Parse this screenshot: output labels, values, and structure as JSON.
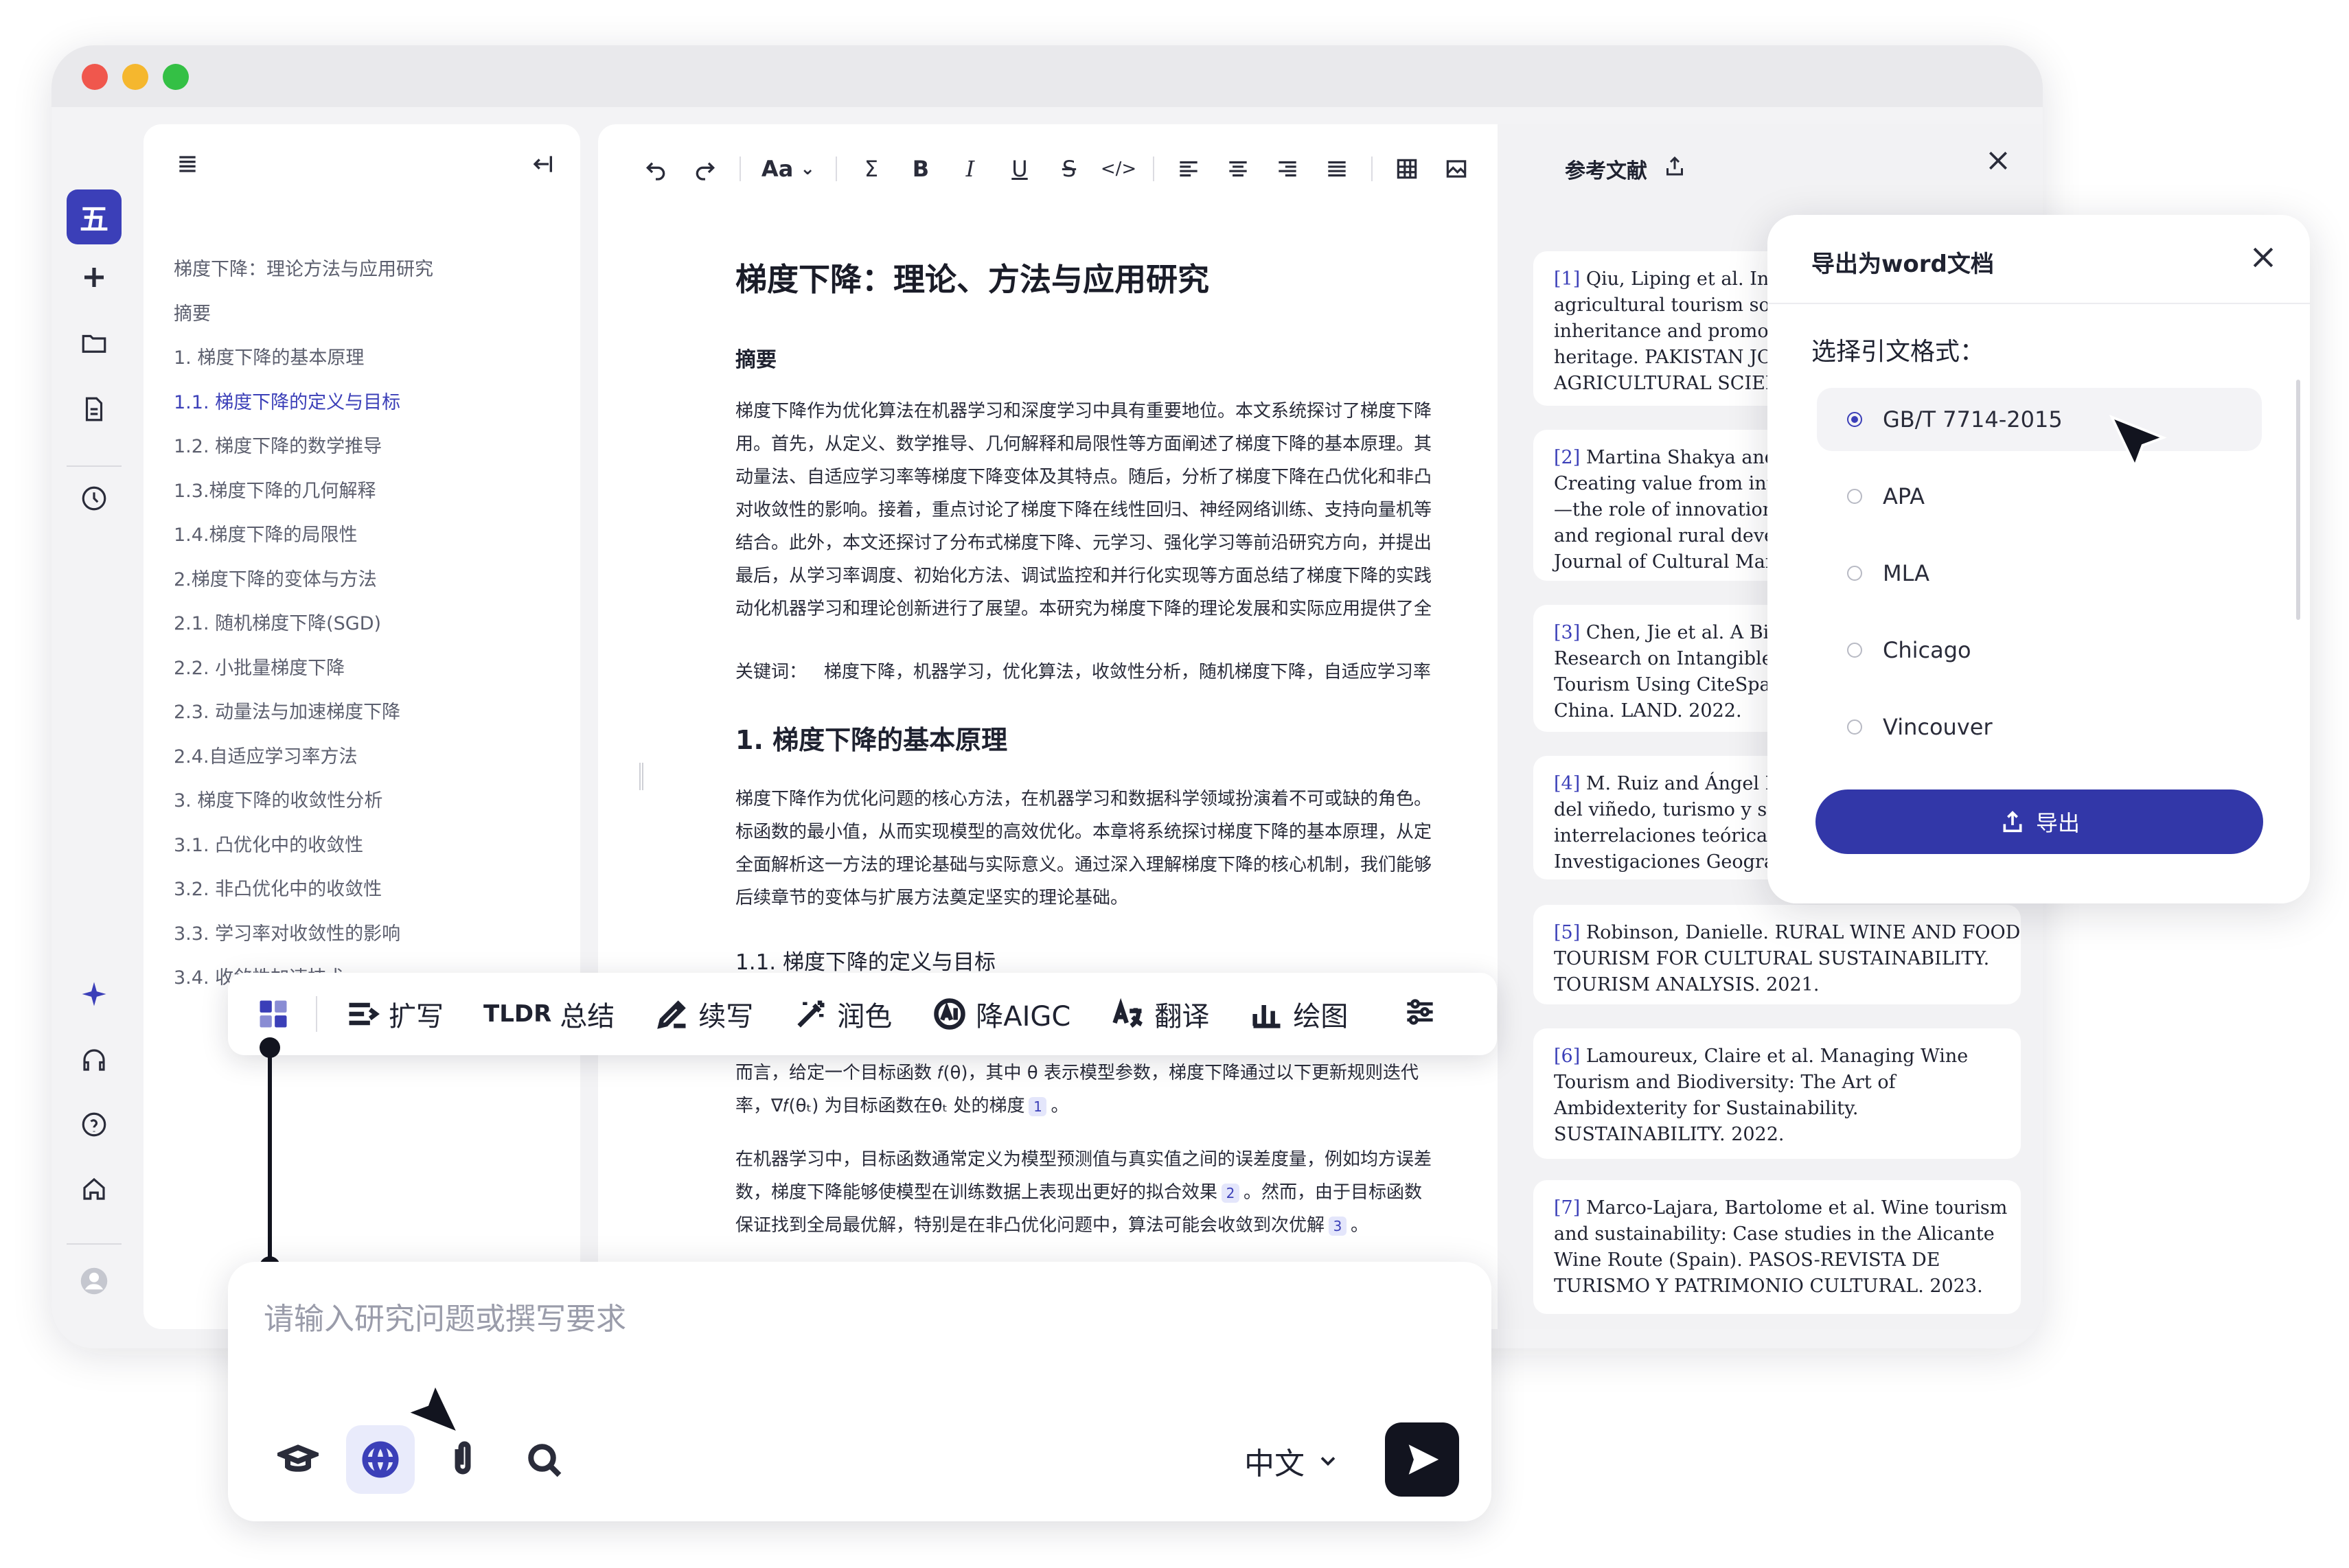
{
  "rail": {
    "logo": "五",
    "icons": [
      "plus-icon",
      "folder-icon",
      "document-icon",
      "clock-icon",
      "sparkle-icon",
      "headphones-icon",
      "help-icon",
      "home-icon",
      "avatar"
    ]
  },
  "outline": {
    "items": [
      {
        "label": "梯度下降：理论方法与应用研究",
        "active": false
      },
      {
        "label": "摘要",
        "active": false
      },
      {
        "label": "1. 梯度下降的基本原理",
        "active": false
      },
      {
        "label": "1.1. 梯度下降的定义与目标",
        "active": true
      },
      {
        "label": "1.2. 梯度下降的数学推导",
        "active": false
      },
      {
        "label": "1.3.梯度下降的几何解释",
        "active": false
      },
      {
        "label": "1.4.梯度下降的局限性",
        "active": false
      },
      {
        "label": "2.梯度下降的变体与方法",
        "active": false
      },
      {
        "label": "2.1. 随机梯度下降(SGD)",
        "active": false
      },
      {
        "label": "2.2. 小批量梯度下降",
        "active": false
      },
      {
        "label": "2.3. 动量法与加速梯度下降",
        "active": false
      },
      {
        "label": "2.4.自适应学习率方法",
        "active": false
      },
      {
        "label": "3. 梯度下降的收敛性分析",
        "active": false
      },
      {
        "label": "3.1. 凸优化中的收敛性",
        "active": false
      },
      {
        "label": "3.2. 非凸优化中的收敛性",
        "active": false
      },
      {
        "label": "3.3. 学习率对收敛性的影响",
        "active": false
      },
      {
        "label": "3.4. 收敛性加速技术",
        "active": false
      }
    ]
  },
  "toolbar": {
    "font_label": "Aa",
    "refs_label": "参考文献"
  },
  "doc": {
    "title": "梯度下降：理论、方法与应用研究",
    "abstract_heading": "摘要",
    "abstract_lines": [
      "梯度下降作为优化算法在机器学习和深度学习中具有重要地位。本文系统探讨了梯度下降",
      "用。首先，从定义、数学推导、几何解释和局限性等方面阐述了梯度下降的基本原理。其",
      "动量法、自适应学习率等梯度下降变体及其特点。随后，分析了梯度下降在凸优化和非凸",
      "对收敛性的影响。接着，重点讨论了梯度下降在线性回归、神经网络训练、支持向量机等",
      "结合。此外，本文还探讨了分布式梯度下降、元学习、强化学习等前沿研究方向，并提出",
      "最后，从学习率调度、初始化方法、调试监控和并行化实现等方面总结了梯度下降的实践",
      "动化机器学习和理论创新进行了展望。本研究为梯度下降的理论发展和实际应用提供了全"
    ],
    "keywords_label": "关键词：",
    "keywords": "梯度下降，机器学习，优化算法，收敛性分析，随机梯度下降，自适应学习率",
    "section1_title": "1. 梯度下降的基本原理",
    "section1_lines": [
      "梯度下降作为优化问题的核心方法，在机器学习和数据科学领域扮演着不可或缺的角色。",
      "标函数的最小值，从而实现模型的高效优化。本章将系统探讨梯度下降的基本原理，从定",
      "全面解析这一方法的理论基础与实际意义。通过深入理解梯度下降的核心机制，我们能够",
      "后续章节的变体与扩展方法奠定坚实的理论基础。"
    ],
    "sub11_title": "1.1. 梯度下降的定义与目标",
    "para2_line1": "而言，给定一个目标函数 𝑓(θ)，其中 θ 表示模型参数，梯度下降通过以下更新规则迭代",
    "para2_line2": "率，∇𝑓(θₜ) 为目标函数在θₜ 处的梯度",
    "cite1": "1",
    "para3_line1": "在机器学习中，目标函数通常定义为模型预测值与真实值之间的误差度量，例如均方误差",
    "para3_line2a": "数，梯度下降能够使模型在训练数据上表现出更好的拟合效果",
    "cite2": "2",
    "para3_line2b": "。然而，由于目标函数",
    "para3_line3a": "保证找到全局最优解，特别是在非凸优化问题中，算法可能会收敛到次优解",
    "cite3": "3",
    "para3_line3b": "。",
    "period": "。"
  },
  "refs": [
    {
      "num": "[1]",
      "lines": [
        "Qiu, Liping et al. Innc",
        "agricultural tourism souv",
        "inheritance and promotic",
        "heritage. PAKISTAN JOUR",
        "AGRICULTURAL SCIENCE"
      ]
    },
    {
      "num": "[2]",
      "lines": [
        "Martina Shakya and C",
        "Creating value from intar",
        "—the role of innovation fc",
        "and regional rural develo",
        "Journal of Cultural Manag"
      ]
    },
    {
      "num": "[3]",
      "lines": [
        "Chen, Jie et al. A Bibli",
        "Research on Intangible C",
        "Tourism Using CiteSpace:",
        "China. LAND. 2022."
      ]
    },
    {
      "num": "[4]",
      "lines": [
        "M. Ruiz and Ángel Ra",
        "del viñedo, turismo y sos",
        "interrelaciones teóricas y",
        "Investigaciones Geográfic"
      ]
    },
    {
      "num": "[5]",
      "lines": [
        "Robinson, Danielle. RURAL WINE AND FOOD",
        "TOURISM FOR CULTURAL SUSTAINABILITY.",
        "TOURISM ANALYSIS. 2021."
      ]
    },
    {
      "num": "[6]",
      "lines": [
        "Lamoureux, Claire et al. Managing Wine",
        "Tourism and Biodiversity: The Art of",
        "Ambidexterity for Sustainability.",
        "SUSTAINABILITY. 2022."
      ]
    },
    {
      "num": "[7]",
      "lines": [
        "Marco-Lajara, Bartolome et al. Wine tourism",
        "and sustainability: Case studies in the Alicante",
        "Wine Route (Spain). PASOS-REVISTA DE",
        "TURISMO Y PATRIMONIO CULTURAL. 2023."
      ]
    }
  ],
  "export": {
    "title": "导出为word文档",
    "subtitle": "选择引文格式：",
    "options": [
      {
        "label": "GB/T 7714-2015",
        "selected": true
      },
      {
        "label": "APA",
        "selected": false
      },
      {
        "label": "MLA",
        "selected": false
      },
      {
        "label": "Chicago",
        "selected": false
      },
      {
        "label": "Vincouver",
        "selected": false
      }
    ],
    "button": "导出"
  },
  "ai_tools": [
    {
      "label": "扩写",
      "icon": "expand-icon"
    },
    {
      "label": "总结",
      "icon": "tldr-icon",
      "prefix": "TLDR"
    },
    {
      "label": "续写",
      "icon": "pen-icon"
    },
    {
      "label": "润色",
      "icon": "magic-wand-icon"
    },
    {
      "label": "降AIGC",
      "icon": "ai-reduce-icon"
    },
    {
      "label": "翻译",
      "icon": "translate-icon"
    },
    {
      "label": "绘图",
      "icon": "bar-chart-icon"
    }
  ],
  "chat": {
    "placeholder": "请输入研究问题或撰写要求",
    "language": "中文"
  },
  "colors": {
    "accent": "#3b3fb8",
    "button": "#3237a8",
    "dark": "#12141f"
  }
}
